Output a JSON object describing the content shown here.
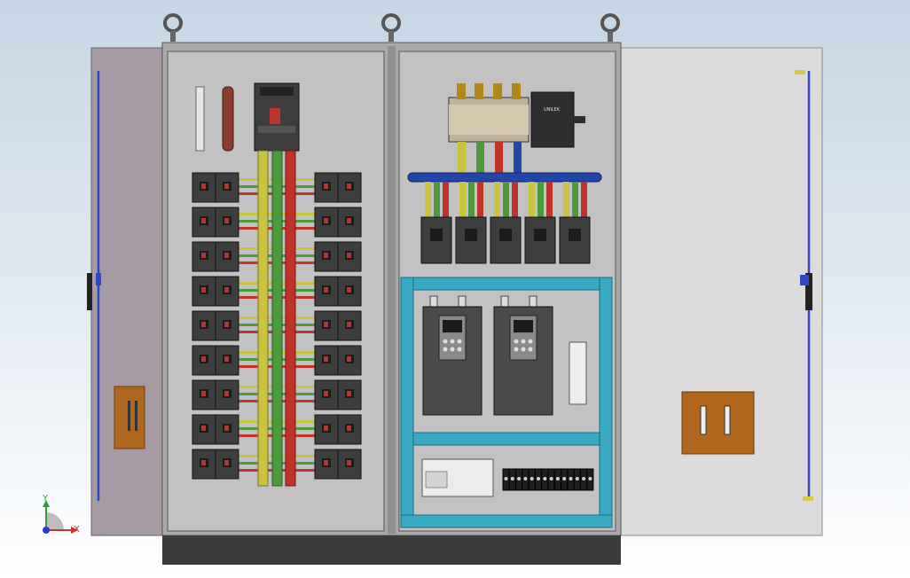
{
  "cabinet": {
    "colors": {
      "frame": "#a9a9ab",
      "door_left": "#a79ba3",
      "door_right": "#dcdcdc",
      "panel": "#c2c2c2",
      "plinth": "#3b3b3b",
      "busbar_yellow": "#c9c340",
      "busbar_green": "#4c9a3c",
      "busbar_red": "#c0322a",
      "busbar_blue": "#2446a8",
      "rail_cyan": "#3aa9c4",
      "handle_blue": "#2f46c8",
      "lock_brown": "#b0661c"
    },
    "left_section": {
      "breaker_rows": 9,
      "breakers_per_side": 2
    },
    "right_section": {
      "outgoing_breakers": 5,
      "vfd_count": 2,
      "terminal_count": 14
    }
  },
  "ats": {
    "brand_label": "UNILEK"
  },
  "axis": {
    "x_label": "X",
    "y_label": "Y",
    "colors": {
      "x": "#c83232",
      "y": "#2e9d3a",
      "z": "#2a3ccf"
    }
  }
}
